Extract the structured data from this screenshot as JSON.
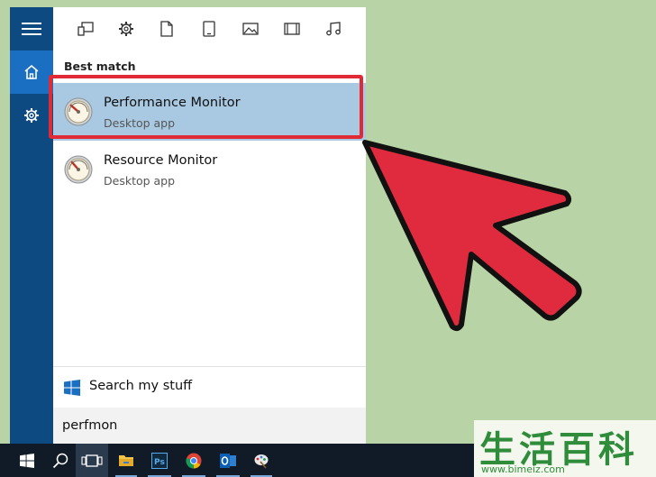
{
  "rail": {
    "menu_icon": "hamburger-icon",
    "home_icon": "home-icon",
    "settings_icon": "gear-icon"
  },
  "filters": [
    "apps-icon",
    "settings-icon",
    "documents-icon",
    "tablet-icon",
    "photos-icon",
    "videos-icon",
    "music-icon"
  ],
  "best_match_label": "Best match",
  "results": [
    {
      "title": "Performance Monitor",
      "subtitle": "Desktop app",
      "selected": true
    },
    {
      "title": "Resource Monitor",
      "subtitle": "Desktop app",
      "selected": false
    }
  ],
  "search_my_stuff": "Search my stuff",
  "search": {
    "value": "perfmon"
  },
  "taskbar": [
    "windows-start-icon",
    "search-icon",
    "task-view-icon",
    "file-explorer-icon",
    "photoshop-icon",
    "chrome-icon",
    "outlook-icon",
    "paint-icon"
  ],
  "colors": {
    "accent": "#1a6fc2",
    "highlight": "#e02a36",
    "selected_row": "#a9c9e3",
    "background": "#b8d4a6"
  },
  "watermark": {
    "chars": "生活百科",
    "url": "www.bimeiz.com"
  }
}
